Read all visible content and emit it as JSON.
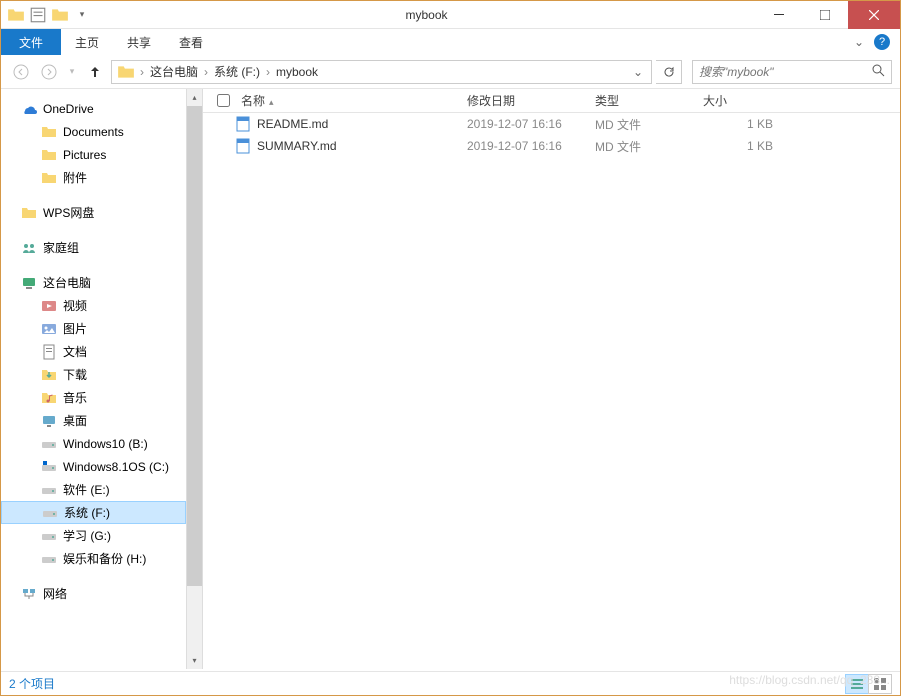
{
  "window": {
    "title": "mybook"
  },
  "ribbon": {
    "file": "文件",
    "tabs": [
      "主页",
      "共享",
      "查看"
    ]
  },
  "address": {
    "segments": [
      "这台电脑",
      "系统 (F:)",
      "mybook"
    ]
  },
  "search": {
    "placeholder": "搜索\"mybook\""
  },
  "sidebar": {
    "groups": [
      {
        "label": "OneDrive",
        "icon": "onedrive",
        "children": [
          {
            "label": "Documents",
            "icon": "folder"
          },
          {
            "label": "Pictures",
            "icon": "folder"
          },
          {
            "label": "附件",
            "icon": "folder"
          }
        ]
      },
      {
        "label": "WPS网盘",
        "icon": "folder"
      },
      {
        "label": "家庭组",
        "icon": "homegroup"
      },
      {
        "label": "这台电脑",
        "icon": "computer",
        "children": [
          {
            "label": "视频",
            "icon": "video"
          },
          {
            "label": "图片",
            "icon": "picture"
          },
          {
            "label": "文档",
            "icon": "doc"
          },
          {
            "label": "下载",
            "icon": "download"
          },
          {
            "label": "音乐",
            "icon": "music"
          },
          {
            "label": "桌面",
            "icon": "desktop"
          },
          {
            "label": "Windows10 (B:)",
            "icon": "drive"
          },
          {
            "label": "Windows8.1OS (C:)",
            "icon": "osdrive"
          },
          {
            "label": "软件 (E:)",
            "icon": "drive"
          },
          {
            "label": "系统 (F:)",
            "icon": "drive",
            "selected": true
          },
          {
            "label": "学习 (G:)",
            "icon": "drive"
          },
          {
            "label": "娱乐和备份 (H:)",
            "icon": "drive"
          }
        ]
      },
      {
        "label": "网络",
        "icon": "network"
      }
    ]
  },
  "columns": {
    "name": "名称",
    "date": "修改日期",
    "type": "类型",
    "size": "大小"
  },
  "files": [
    {
      "name": "README.md",
      "date": "2019-12-07 16:16",
      "type": "MD 文件",
      "size": "1 KB",
      "icon": "md"
    },
    {
      "name": "SUMMARY.md",
      "date": "2019-12-07 16:16",
      "type": "MD 文件",
      "size": "1 KB",
      "icon": "md"
    }
  ],
  "status": {
    "text": "2 个项目"
  },
  "watermark": "https://blog.csdn.net/qq_238..."
}
